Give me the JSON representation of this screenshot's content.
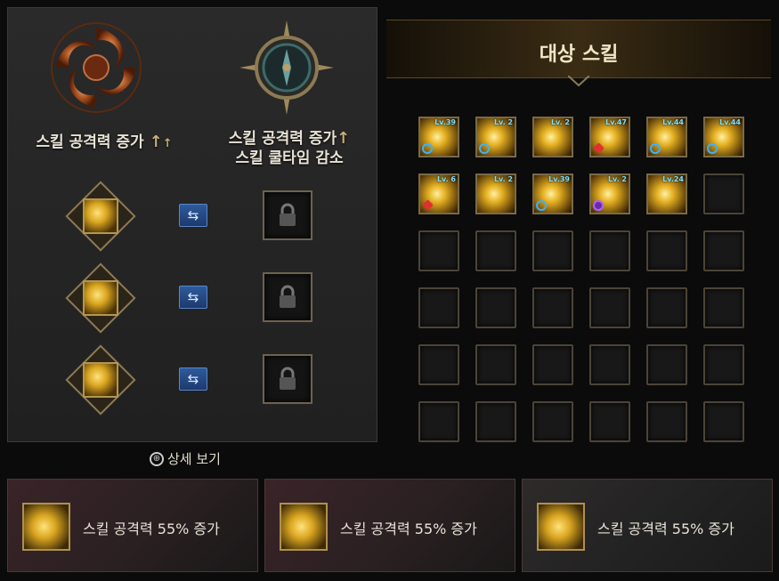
{
  "left_panel": {
    "title1": "스킬 공격력 증가",
    "title2_line1": "스킬 공격력 증가",
    "title2_line2": "스킬 쿨타임 감소",
    "arrow": "↑",
    "swap_glyph": "⇆"
  },
  "detail_link": "상세 보기",
  "detail_icon": "⊕",
  "right_panel": {
    "header": "대상 스킬",
    "skills": [
      {
        "level": "Lv.39",
        "mark": "blue"
      },
      {
        "level": "Lv. 2",
        "mark": "blue"
      },
      {
        "level": "Lv. 2",
        "mark": ""
      },
      {
        "level": "Lv.47",
        "mark": "red"
      },
      {
        "level": "Lv.44",
        "mark": "blue"
      },
      {
        "level": "Lv.44",
        "mark": "blue"
      },
      {
        "level": "Lv. 6",
        "mark": "red"
      },
      {
        "level": "Lv. 2",
        "mark": ""
      },
      {
        "level": "Lv.39",
        "mark": "blue"
      },
      {
        "level": "Lv. 2",
        "mark": "purple"
      },
      {
        "level": "Lv.24",
        "mark": ""
      }
    ],
    "total_slots": 36
  },
  "bottom_panels": [
    {
      "text": "스킬 공격력 55% 증가"
    },
    {
      "text": "스킬 공격력 55% 증가"
    },
    {
      "text": "스킬 공격력 55% 증가"
    }
  ],
  "colors": {
    "gold": "#d9a520",
    "swap_blue": "#2f5a9c",
    "level_text": "#7ee0ff"
  }
}
